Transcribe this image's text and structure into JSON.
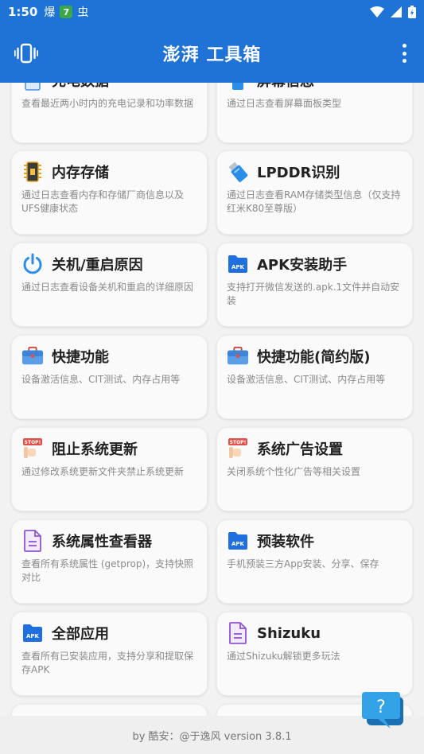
{
  "status": {
    "time": "1:50",
    "icon1": "爆",
    "icon2": "7",
    "icon3": "虫"
  },
  "app": {
    "title": "澎湃 工具箱"
  },
  "cards": [
    {
      "title": "充电数据",
      "desc": "查看最近两小时内的充电记录和功率数据",
      "icon": "battery-doc-icon"
    },
    {
      "title": "屏幕信息",
      "desc": "通过日志查看屏幕面板类型",
      "icon": "screen-icon"
    },
    {
      "title": "内存存储",
      "desc": "通过日志查看内存和存储厂商信息以及UFS健康状态",
      "icon": "memory-chip-icon"
    },
    {
      "title": "LPDDR识别",
      "desc": "通过日志查看RAM存储类型信息（仅支持红米K80至尊版）",
      "icon": "usb-drive-icon"
    },
    {
      "title": "关机/重启原因",
      "desc": "通过日志查看设备关机和重启的详细原因",
      "icon": "power-icon"
    },
    {
      "title": "APK安装助手",
      "desc": "支持打开微信发送的.apk.1文件并自动安装",
      "icon": "apk-file-icon"
    },
    {
      "title": "快捷功能",
      "desc": "设备激活信息、CIT测试、内存占用等",
      "icon": "toolbox-icon"
    },
    {
      "title": "快捷功能(简约版)",
      "desc": "设备激活信息、CIT测试、内存占用等",
      "icon": "toolbox-icon"
    },
    {
      "title": "阻止系统更新",
      "desc": "通过修改系统更新文件夹禁止系统更新",
      "icon": "stop-hand-icon"
    },
    {
      "title": "系统广告设置",
      "desc": "关闭系统个性化广告等相关设置",
      "icon": "stop-hand-icon"
    },
    {
      "title": "系统属性查看器",
      "desc": "查看所有系统属性 (getprop)，支持快照对比",
      "icon": "document-icon"
    },
    {
      "title": "预装软件",
      "desc": "手机预装三方App安装、分享、保存",
      "icon": "apk-file-icon"
    },
    {
      "title": "全部应用",
      "desc": "查看所有已安装应用，支持分享和提取保存APK",
      "icon": "apk-file-icon"
    },
    {
      "title": "Shizuku",
      "desc": "通过Shizuku解锁更多玩法",
      "icon": "document-icon"
    }
  ],
  "footer": {
    "text": "by 酷安：@于逸风 version 3.8.1"
  },
  "apk_label": "APK",
  "stop_label": "STOP!",
  "help_label": "?",
  "colors": {
    "primary": "#1f73d6",
    "apk_blue": "#1f6fe0",
    "doc_purple": "#8e57d6",
    "stop_red": "#e0504a",
    "help_blue": "#33a2e6"
  }
}
